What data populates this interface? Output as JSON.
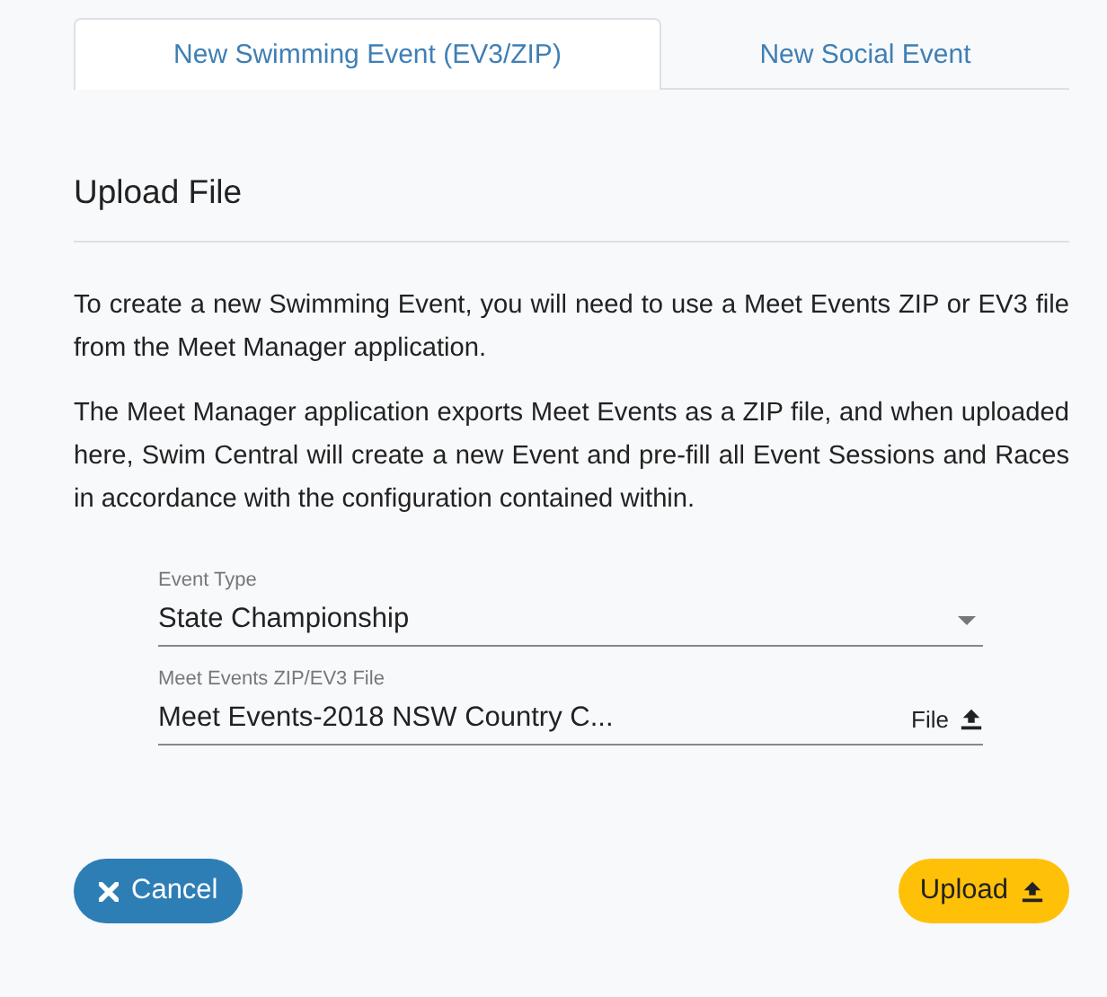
{
  "tabs": [
    {
      "label": "New Swimming Event (EV3/ZIP)",
      "selected": true
    },
    {
      "label": "New Social Event",
      "selected": false
    }
  ],
  "heading": "Upload File",
  "paragraphs": [
    "To create a new Swimming Event, you will need to use a Meet Events ZIP or EV3 file from the Meet Manager application.",
    "The Meet Manager application exports Meet Events as a ZIP file, and when uploaded here, Swim Central will create a new Event and pre-fill all Event Sessions and Races in accordance with the configuration contained within."
  ],
  "fields": [
    {
      "kind": "select",
      "label": "Event Type",
      "value": "State Championship"
    },
    {
      "kind": "file",
      "label": "Meet Events ZIP/EV3 File",
      "value": "Meet Events-2018 NSW Country C...",
      "action": "File"
    }
  ],
  "buttons": [
    {
      "kind": "cancel",
      "label": "Cancel"
    },
    {
      "kind": "upload",
      "label": "Upload"
    }
  ]
}
